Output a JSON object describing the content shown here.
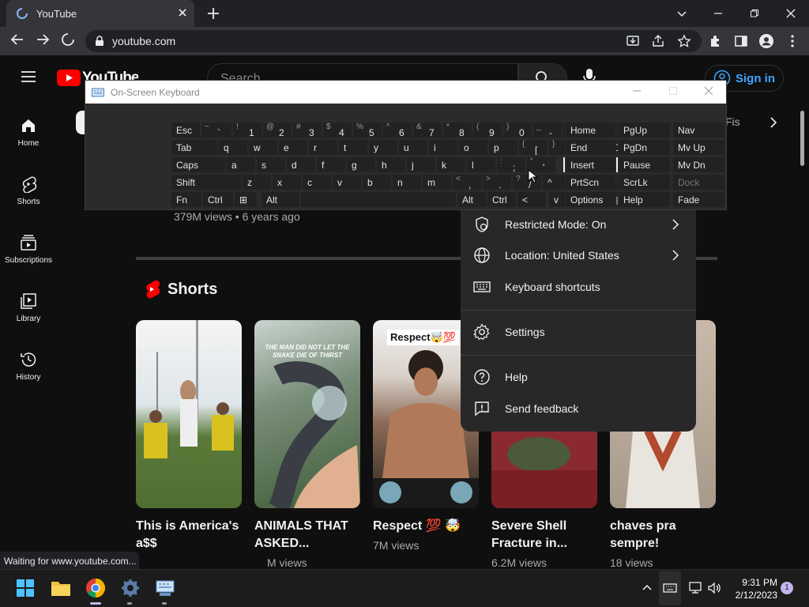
{
  "browser": {
    "tab_title": "YouTube",
    "url": "youtube.com",
    "status": "Waiting for www.youtube.com..."
  },
  "youtube": {
    "logo_text": "YouTube",
    "search_placeholder": "Search",
    "sign_in": "Sign in",
    "chip_overflow": "Fis",
    "nav": [
      {
        "label": "Home",
        "icon": "home-icon"
      },
      {
        "label": "Shorts",
        "icon": "shorts-icon"
      },
      {
        "label": "Subscriptions",
        "icon": "subscriptions-icon"
      },
      {
        "label": "Library",
        "icon": "library-icon"
      },
      {
        "label": "History",
        "icon": "history-icon"
      }
    ],
    "video_meta": "379M views • 6 years ago",
    "shorts_heading": "Shorts",
    "shorts": [
      {
        "title": "This is America's a$$",
        "views": "",
        "thumb": "#5b7a3a"
      },
      {
        "title": "ANIMALS THAT ASKED...",
        "views": "M views",
        "thumb": "#3d5a35",
        "caption": "THE MAN DID NOT LET THE SNAKE DIE OF THIRST"
      },
      {
        "title": "Respect 💯 🤯",
        "views": "7M views",
        "thumb": "#8a6a55",
        "caption": "Respect🤯💯"
      },
      {
        "title": "Severe Shell Fracture in...",
        "views": "6.2M views",
        "thumb": "#8a2a30"
      },
      {
        "title": "chaves pra sempre!",
        "views": "18 views",
        "thumb": "#a89a8a"
      }
    ]
  },
  "menu": {
    "items": [
      {
        "label": "Restricted Mode: On",
        "icon": "shield-icon",
        "chevron": true
      },
      {
        "label": "Location: United States",
        "icon": "globe-icon",
        "chevron": true
      },
      {
        "label": "Keyboard shortcuts",
        "icon": "keyboard-icon",
        "chevron": false
      },
      {
        "label": "Settings",
        "icon": "gear-icon",
        "chevron": false
      },
      {
        "label": "Help",
        "icon": "help-icon",
        "chevron": false
      },
      {
        "label": "Send feedback",
        "icon": "feedback-icon",
        "chevron": false
      }
    ]
  },
  "osk": {
    "title": "On-Screen Keyboard",
    "rows": [
      [
        [
          "Esc",
          ""
        ],
        [
          "`",
          "~"
        ],
        [
          "1",
          "!"
        ],
        [
          "2",
          "@"
        ],
        [
          "3",
          "#"
        ],
        [
          "4",
          "$"
        ],
        [
          "5",
          "%"
        ],
        [
          "6",
          "^"
        ],
        [
          "7",
          "&"
        ],
        [
          "8",
          "*"
        ],
        [
          "9",
          "("
        ],
        [
          "0",
          ")"
        ],
        [
          "-",
          "_"
        ],
        [
          "=",
          "+"
        ],
        [
          "⌫",
          ""
        ]
      ],
      [
        [
          "Tab",
          ""
        ],
        [
          "q",
          ""
        ],
        [
          "w",
          ""
        ],
        [
          "e",
          ""
        ],
        [
          "r",
          ""
        ],
        [
          "t",
          ""
        ],
        [
          "y",
          ""
        ],
        [
          "u",
          ""
        ],
        [
          "i",
          ""
        ],
        [
          "o",
          ""
        ],
        [
          "p",
          ""
        ],
        [
          "[",
          "{"
        ],
        [
          "]",
          "}"
        ],
        [
          "\\",
          "|"
        ],
        [
          "Del",
          ""
        ]
      ],
      [
        [
          "Caps",
          ""
        ],
        [
          "a",
          ""
        ],
        [
          "s",
          ""
        ],
        [
          "d",
          ""
        ],
        [
          "f",
          ""
        ],
        [
          "g",
          ""
        ],
        [
          "h",
          ""
        ],
        [
          "j",
          ""
        ],
        [
          "k",
          ""
        ],
        [
          "l",
          ""
        ],
        [
          ";",
          ":"
        ],
        [
          "'",
          "\""
        ],
        [
          "Enter",
          ""
        ]
      ],
      [
        [
          "Shift",
          ""
        ],
        [
          "z",
          ""
        ],
        [
          "x",
          ""
        ],
        [
          "c",
          ""
        ],
        [
          "v",
          ""
        ],
        [
          "b",
          ""
        ],
        [
          "n",
          ""
        ],
        [
          "m",
          ""
        ],
        [
          ",",
          "<"
        ],
        [
          ".",
          ">"
        ],
        [
          "/",
          "?"
        ],
        [
          "^",
          ""
        ],
        [
          "Shift",
          ""
        ]
      ],
      [
        [
          "Fn",
          ""
        ],
        [
          "Ctrl",
          ""
        ],
        [
          "⊞",
          ""
        ],
        [
          "Alt",
          ""
        ],
        [
          "",
          ""
        ],
        [
          "Alt",
          ""
        ],
        [
          "Ctrl",
          ""
        ],
        [
          "<",
          ""
        ],
        [
          "v",
          ""
        ],
        [
          ">",
          ""
        ],
        [
          "▤",
          ""
        ]
      ]
    ],
    "nav_keys": [
      [
        "Home",
        "PgUp",
        "Nav"
      ],
      [
        "End",
        "PgDn",
        "Mv Up"
      ],
      [
        "Insert",
        "Pause",
        "Mv Dn"
      ],
      [
        "PrtScn",
        "ScrLk",
        "Dock"
      ],
      [
        "Options",
        "Help",
        "Fade"
      ]
    ]
  },
  "taskbar": {
    "time": "9:31 PM",
    "date": "2/12/2023",
    "notifications": "1"
  }
}
